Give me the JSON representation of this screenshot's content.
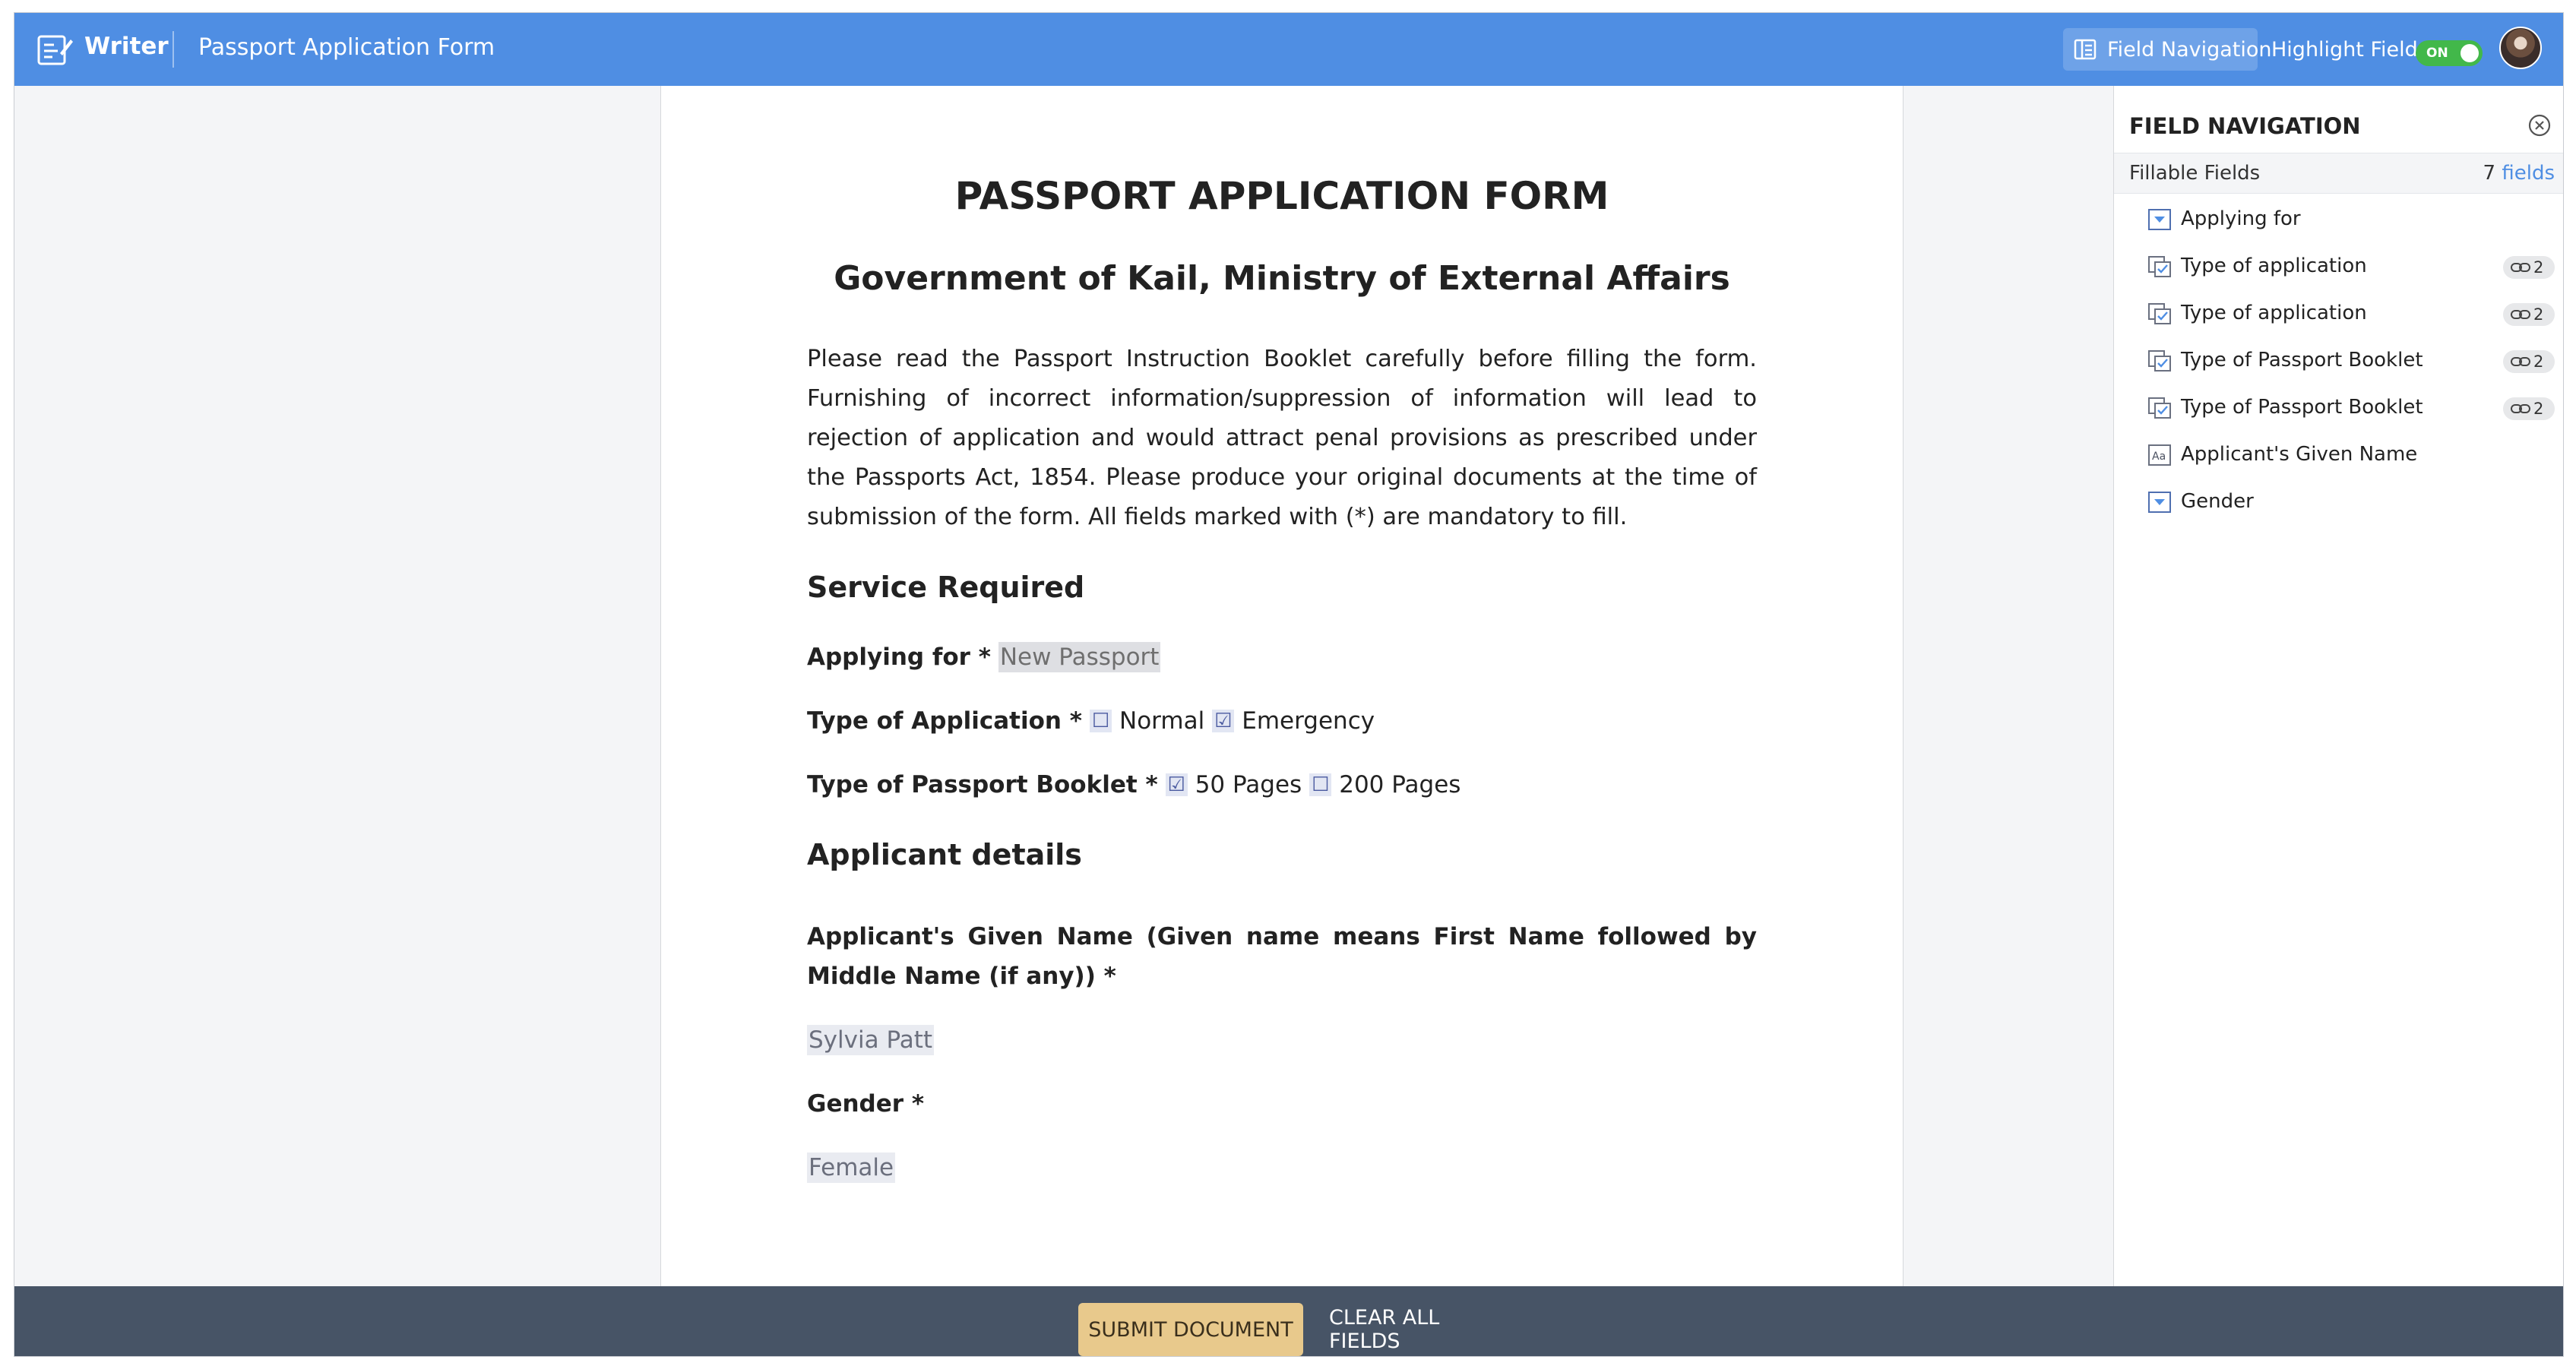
{
  "header": {
    "app_name": "Writer",
    "doc_title": "Passport Application Form",
    "field_nav_label": "Field Navigation",
    "highlight_label": "Highlight Fields",
    "toggle_text": "ON",
    "toggle_on": true,
    "accent": "#4f8ee3"
  },
  "document": {
    "title": "PASSPORT APPLICATION FORM",
    "subtitle": "Government of Kail, Ministry of External Affairs",
    "intro": "Please read the Passport Instruction Booklet carefully before filling the form. Furnishing of incorrect information/suppression of information will lead to rejection of application and would attract penal provisions as prescribed under the Passports Act, 1854. Please produce your original documents at the time of submission of the form. All fields marked with (*) are mandatory to fill.",
    "section_service": "Service Required",
    "applying_for": {
      "label": "Applying for *",
      "value": "New Passport"
    },
    "type_application": {
      "label": "Type of Application *",
      "options": [
        {
          "label": "Normal",
          "checked": false,
          "glyph": "☐"
        },
        {
          "label": "Emergency",
          "checked": true,
          "glyph": "☑"
        }
      ]
    },
    "type_booklet": {
      "label": "Type of Passport Booklet *",
      "options": [
        {
          "label": "50 Pages",
          "checked": true,
          "glyph": "☑"
        },
        {
          "label": "200 Pages",
          "checked": false,
          "glyph": "☐"
        }
      ]
    },
    "section_applicant": "Applicant details",
    "given_name": {
      "label": "Applicant's Given Name (Given name means First Name followed by Middle Name (if any)) *",
      "value": "Sylvia Patt"
    },
    "gender": {
      "label": "Gender *",
      "value": "Female"
    }
  },
  "panel": {
    "title": "FIELD NAVIGATION",
    "sub_label": "Fillable Fields",
    "count": "7",
    "count_word": "fields",
    "items": [
      {
        "icon": "dropdown-icon",
        "label": "Applying for",
        "badge": ""
      },
      {
        "icon": "checkbox-group-icon",
        "label": "Type of application",
        "badge": "2"
      },
      {
        "icon": "checkbox-group-icon",
        "label": "Type of application",
        "badge": "2"
      },
      {
        "icon": "checkbox-group-icon",
        "label": "Type of Passport Booklet",
        "badge": "2"
      },
      {
        "icon": "checkbox-group-icon",
        "label": "Type of Passport Booklet",
        "badge": "2"
      },
      {
        "icon": "text-field-icon",
        "label": "Applicant's Given Name",
        "badge": ""
      },
      {
        "icon": "dropdown-icon",
        "label": "Gender",
        "badge": ""
      }
    ]
  },
  "footer": {
    "submit_label": "SUBMIT DOCUMENT",
    "clear_label": "CLEAR ALL FIELDS"
  }
}
